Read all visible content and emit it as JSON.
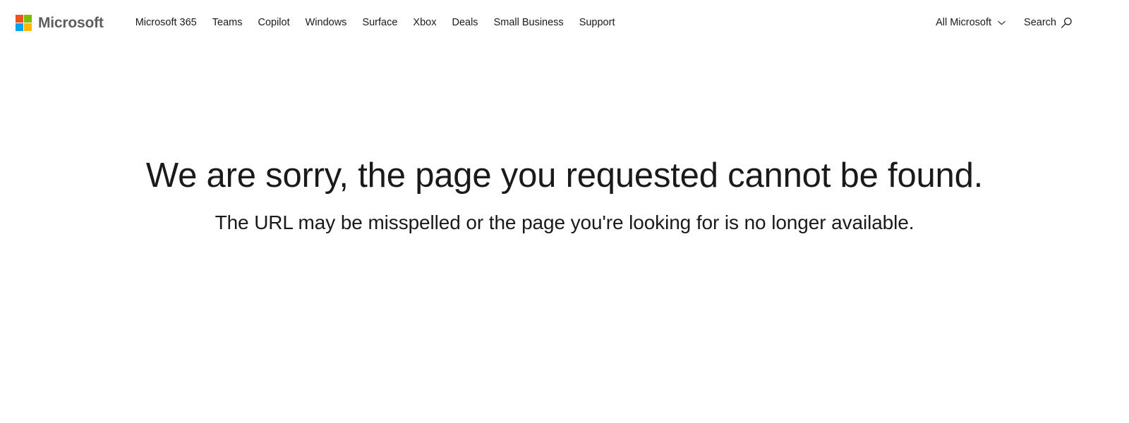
{
  "header": {
    "brand": {
      "name": "Microsoft",
      "logo_icon": "microsoft-logo-icon",
      "logo_colors": {
        "top_left": "#f25022",
        "top_right": "#7fba00",
        "bottom_left": "#00a4ef",
        "bottom_right": "#ffb900"
      }
    },
    "nav_items": [
      {
        "label": "Microsoft 365"
      },
      {
        "label": "Teams"
      },
      {
        "label": "Copilot"
      },
      {
        "label": "Windows"
      },
      {
        "label": "Surface"
      },
      {
        "label": "Xbox"
      },
      {
        "label": "Deals"
      },
      {
        "label": "Small Business"
      },
      {
        "label": "Support"
      }
    ],
    "all_microsoft": {
      "label": "All Microsoft",
      "chevron_icon": "chevron-down-icon"
    },
    "search": {
      "label": "Search",
      "icon": "search-icon"
    },
    "text_color": "#1a1a1a",
    "brand_text_color": "#5e5e5e",
    "background": "#ffffff"
  },
  "main": {
    "title": "We are sorry, the page you requested cannot be found.",
    "subtitle": "The URL may be misspelled or the page you're looking for is no longer available."
  }
}
